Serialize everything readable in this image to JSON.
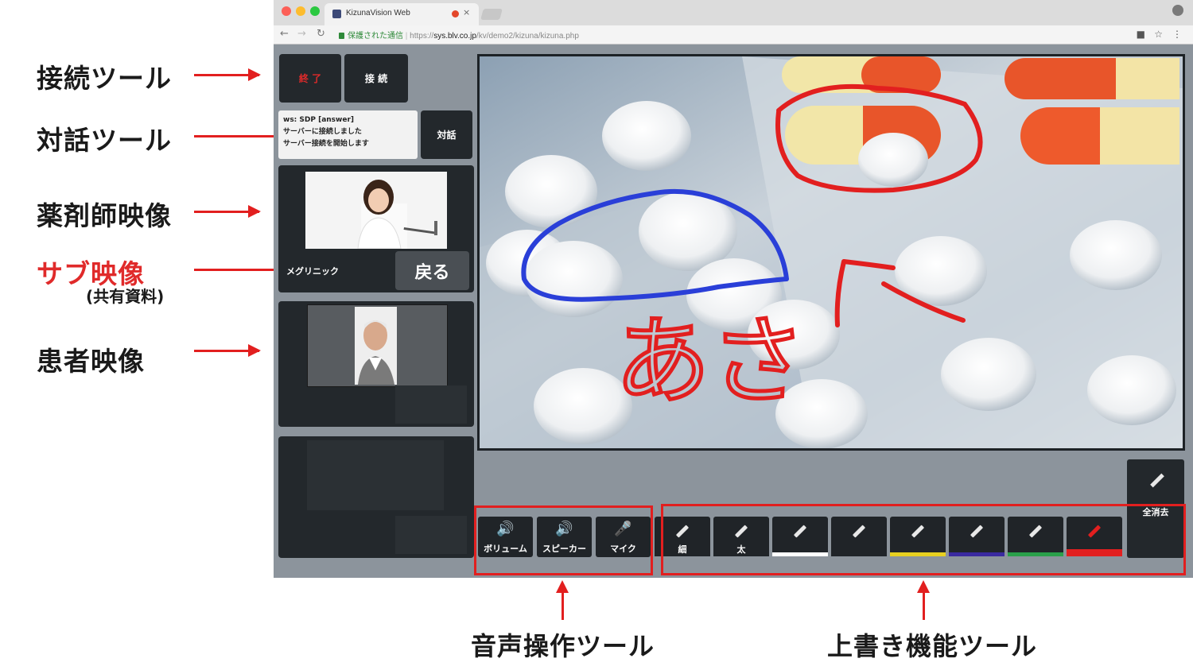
{
  "annotations": {
    "connection_tool": "接続ツール",
    "dialog_tool": "対話ツール",
    "pharmacist_video": "薬剤師映像",
    "sub_video": "サブ映像",
    "sub_video_note": "(共有資料)",
    "patient_video": "患者映像",
    "audio_tool": "音声操作ツール",
    "overwrite_tool": "上書き機能ツール"
  },
  "browser": {
    "tab_title": "KizunaVision Web",
    "secure_label": "保護された通信",
    "url_scheme": "https://",
    "url_host": "sys.blv.co.jp",
    "url_path": "/kv/demo2/kizuna/kizuna.php"
  },
  "connection": {
    "end_label": "終 了",
    "connect_label": "接 続"
  },
  "dialog": {
    "log_lines": [
      "ws: SDP [answer]",
      "サーバーに接続しました",
      "サーバー接続を開始します"
    ],
    "talk_label": "対話"
  },
  "sub_video": {
    "caption": "メグリニック",
    "back_label": "戻る"
  },
  "audio": {
    "volume_label": "ボリューム",
    "speaker_label": "スピーカー",
    "mic_label": "マイク"
  },
  "drawing": {
    "pens": [
      {
        "label": "細",
        "color": "#202428",
        "icon": "pen-thin-icon"
      },
      {
        "label": "太",
        "color": "#202428",
        "icon": "pen-thick-icon"
      },
      {
        "label": "",
        "color": "#ffffff",
        "icon": "pen-white-icon"
      },
      {
        "label": "",
        "color": "#202428",
        "icon": "pen-black-icon"
      },
      {
        "label": "",
        "color": "#e8d020",
        "icon": "pen-yellow-icon"
      },
      {
        "label": "",
        "color": "#3a2aa0",
        "icon": "pen-purple-icon"
      },
      {
        "label": "",
        "color": "#2aa04a",
        "icon": "pen-green-icon"
      },
      {
        "label": "",
        "color": "#e21f1f",
        "icon": "pen-red-icon"
      }
    ],
    "clear_all_label": "全消去",
    "handwriting_text": "あさ"
  }
}
